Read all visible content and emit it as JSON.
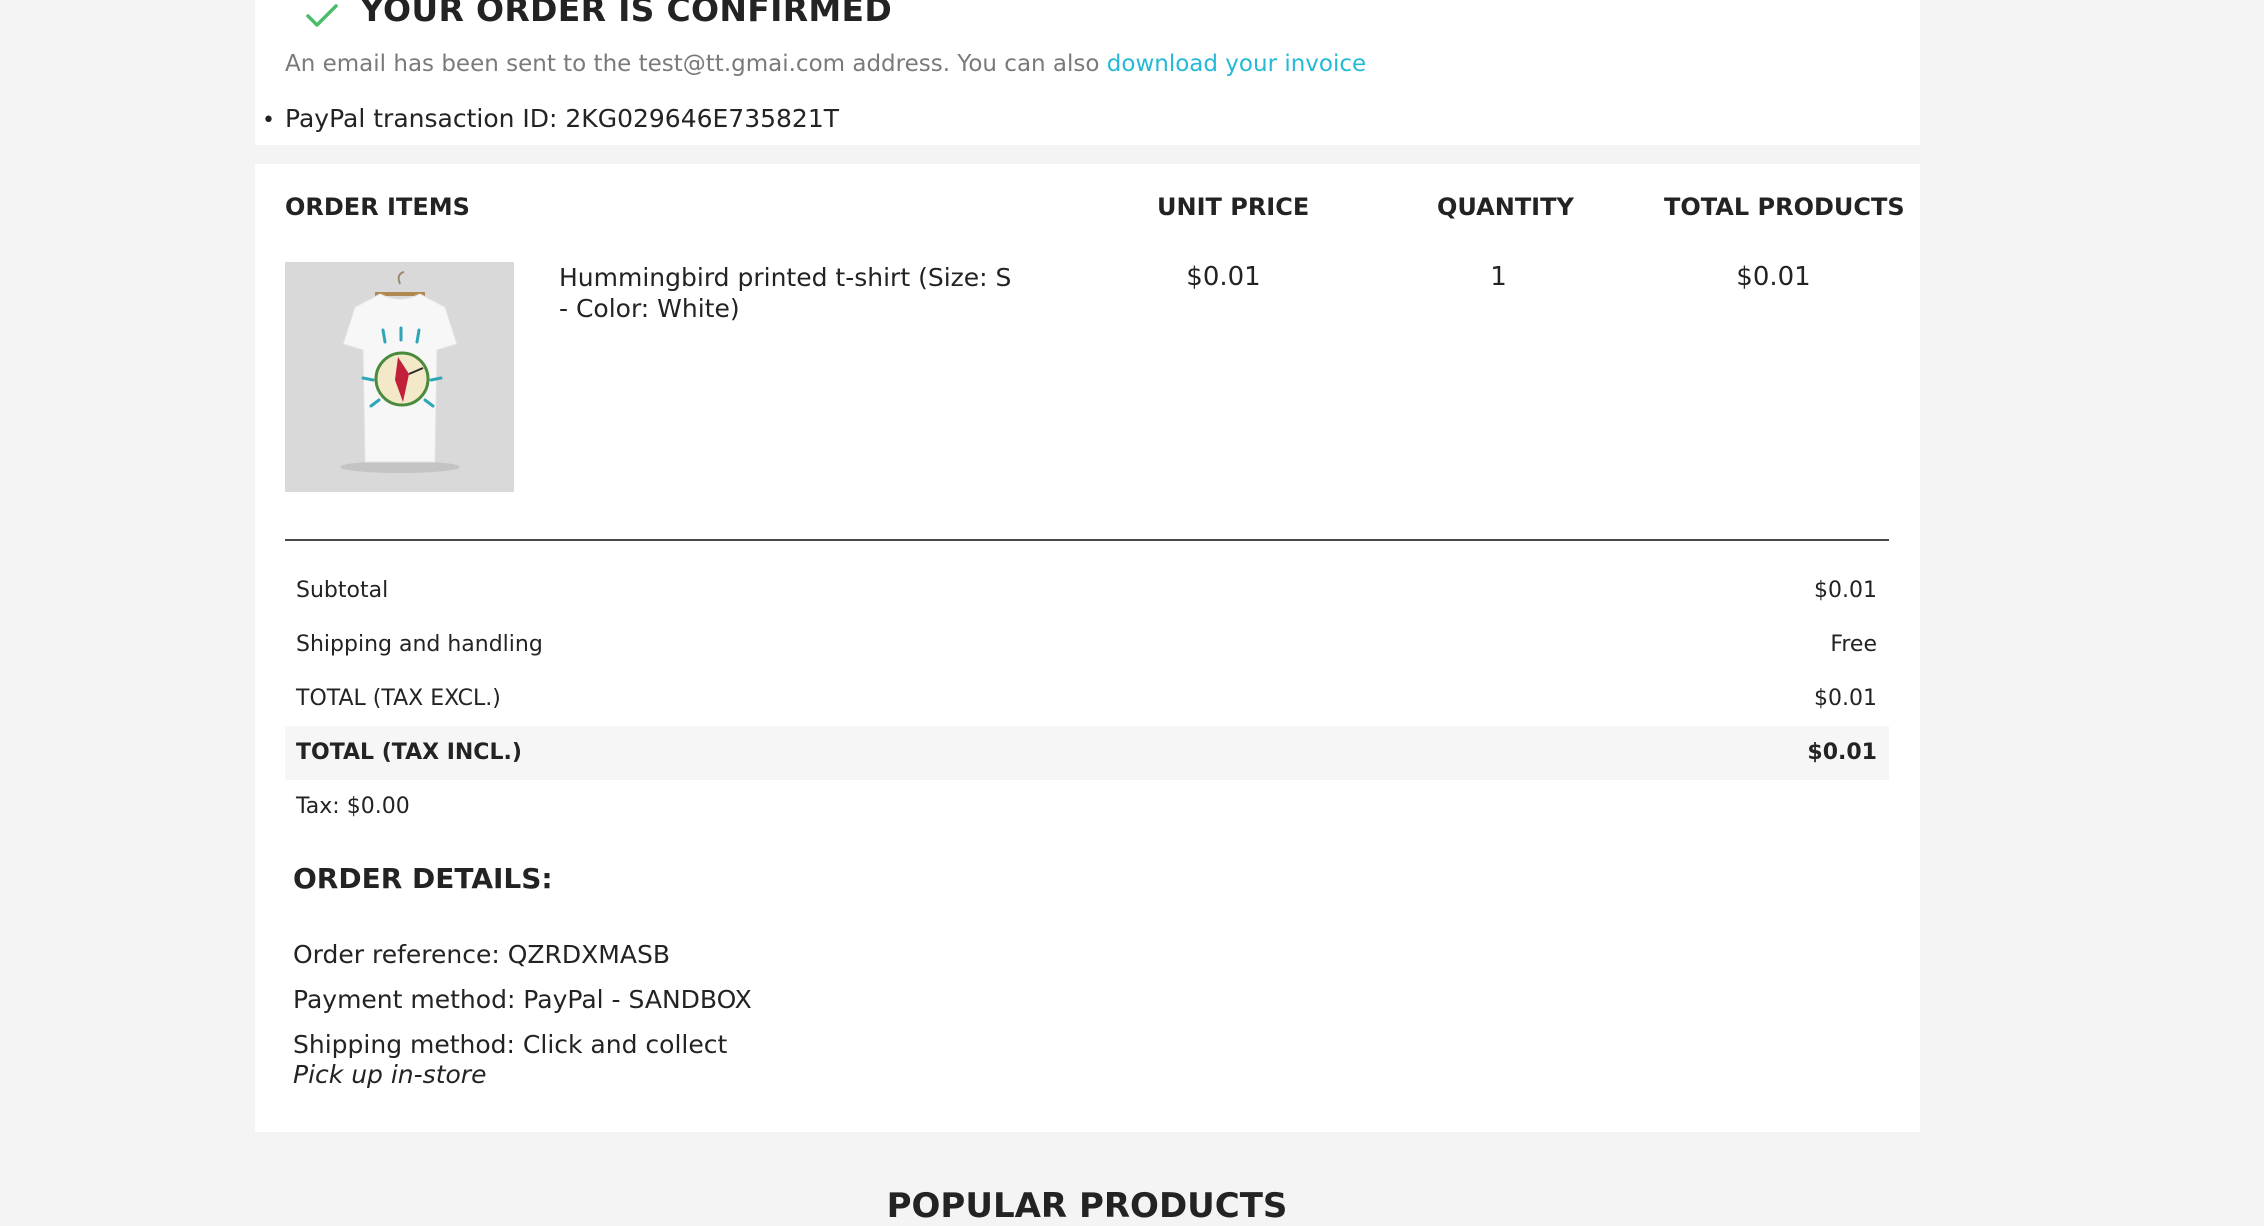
{
  "confirmation": {
    "title": "YOUR ORDER IS CONFIRMED",
    "email_text": "An email has been sent to the test@tt.gmai.com address. You can also ",
    "invoice_link": "download your invoice",
    "transaction": "PayPal transaction ID: 2KG029646E735821T",
    "accent_color": "#24b9d7",
    "check_color": "#4cbb6c"
  },
  "items_table": {
    "headers": {
      "items": "ORDER ITEMS",
      "unit_price": "UNIT PRICE",
      "quantity": "QUANTITY",
      "total": "TOTAL PRODUCTS"
    },
    "rows": [
      {
        "name": "Hummingbird printed t-shirt (Size: S - Color: White)",
        "unit_price": "$0.01",
        "quantity": "1",
        "total": "$0.01",
        "image_icon": "tshirt-icon"
      }
    ]
  },
  "totals": {
    "subtotal_label": "Subtotal",
    "subtotal_value": "$0.01",
    "shipping_label": "Shipping and handling",
    "shipping_value": "Free",
    "tax_excl_label": "TOTAL (TAX EXCL.)",
    "tax_excl_value": "$0.01",
    "tax_incl_label": "TOTAL (TAX INCL.)",
    "tax_incl_value": "$0.01",
    "tax_label": "Tax: $0.00"
  },
  "order_details": {
    "title": "ORDER DETAILS:",
    "reference": "Order reference: QZRDXMASB",
    "payment": "Payment method: PayPal - SANDBOX",
    "shipping": "Shipping method: Click and collect",
    "shipping_note": "Pick up in-store"
  },
  "popular": {
    "title": "POPULAR PRODUCTS"
  }
}
